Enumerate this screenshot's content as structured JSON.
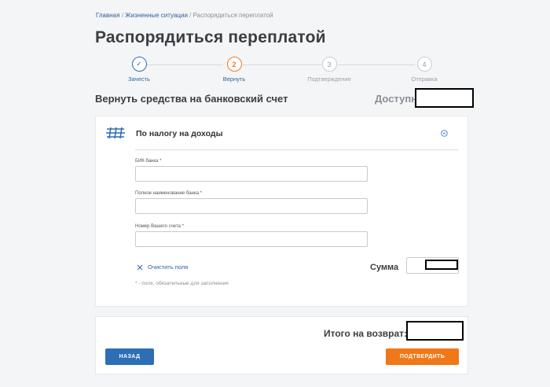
{
  "breadcrumb": {
    "items": [
      "Главная",
      "Жизненные ситуации"
    ],
    "current": "Распорядиться переплатой",
    "separator": "/"
  },
  "page_title": "Распорядиться переплатой",
  "stepper": {
    "steps": [
      {
        "number": "✓",
        "label": "Зачесть",
        "state": "done"
      },
      {
        "number": "2",
        "label": "Вернуть",
        "state": "active"
      },
      {
        "number": "3",
        "label": "Подтверждение",
        "state": "todo"
      },
      {
        "number": "4",
        "label": "Отправка",
        "state": "todo"
      }
    ]
  },
  "section": {
    "title": "Вернуть средства на банковский счет",
    "available_label": "Доступно:"
  },
  "card": {
    "title": "По налогу на доходы",
    "icon": "tax-document-icon",
    "collapse_icon": "collapse-circle-icon",
    "fields": [
      {
        "label": "БИК банка *",
        "value": "",
        "placeholder": ""
      },
      {
        "label": "Полное наименование банка *",
        "value": "",
        "placeholder": ""
      },
      {
        "label": "Номер Вашего счета *",
        "value": "",
        "placeholder": ""
      }
    ],
    "clear_label": "Очистить поля",
    "required_note": "* - поля, обязательные для заполнения",
    "sum_label": "Сумма"
  },
  "footer": {
    "total_label": "Итого на возврат:",
    "back_label": "НАЗАД",
    "confirm_label": "ПОДТВЕРДИТЬ"
  },
  "colors": {
    "accent_blue": "#2d6fb4",
    "accent_orange": "#f07818",
    "link": "#2b5f9e",
    "background": "#f4f5f7"
  }
}
